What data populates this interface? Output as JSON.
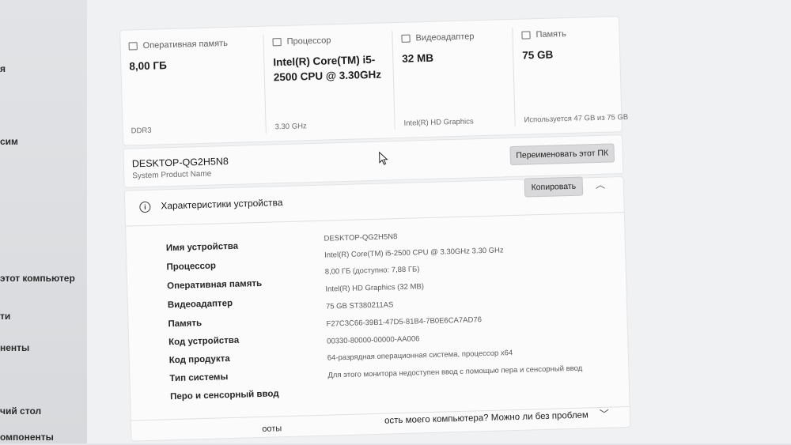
{
  "sidebar": {
    "items": [
      {
        "label": "я"
      },
      {
        "label": "сим"
      },
      {
        "label": "этот компьютер"
      },
      {
        "label": "ти"
      },
      {
        "label": "ненты"
      },
      {
        "label": "чий стол"
      },
      {
        "label": "омпоненты"
      }
    ]
  },
  "tiles": [
    {
      "label": "Оперативная память",
      "value": "8,00 ГБ",
      "sub": "DDR3"
    },
    {
      "label": "Процессор",
      "value": "Intel(R) Core(TM) i5-2500 CPU @ 3.30GHz",
      "sub": "3.30 GHz"
    },
    {
      "label": "Видеоадаптер",
      "value": "32 MB",
      "sub": "Intel(R) HD Graphics"
    },
    {
      "label": "Память",
      "value": "75 GB",
      "sub": "Используется 47 GB из 75 GB"
    }
  ],
  "pc": {
    "name": "DESKTOP-QG2H5N8",
    "model": "System Product Name",
    "rename_label": "Переименовать этот ПК"
  },
  "specs": {
    "title": "Характеристики устройства",
    "copy_label": "Копировать",
    "rows": [
      {
        "key": "Имя устройства",
        "value": "DESKTOP-QG2H5N8"
      },
      {
        "key": "Процессор",
        "value": "Intel(R) Core(TM) i5-2500 CPU @ 3.30GHz   3.30 GHz"
      },
      {
        "key": "Оперативная память",
        "value": "8,00 ГБ (доступно: 7,88 ГБ)"
      },
      {
        "key": "Видеоадаптер",
        "value": "Intel(R) HD Graphics (32 MB)"
      },
      {
        "key": "Память",
        "value": "75 GB ST380211AS"
      },
      {
        "key": "Код устройства",
        "value": "F27C3C66-39B1-47D5-81B4-7B0E6CA7AD76"
      },
      {
        "key": "Код продукта",
        "value": "00330-80000-00000-AA006"
      },
      {
        "key": "Тип системы",
        "value": "64-разрядная операционная система, процессор x64"
      },
      {
        "key": "Перо и сенсорный ввод",
        "value": "Для этого монитора недоступен ввод с помощью пера и сенсорный ввод"
      }
    ]
  },
  "bottom": {
    "left_text": "ооты",
    "question": "ость моего компьютера? Можно ли без проблем"
  }
}
